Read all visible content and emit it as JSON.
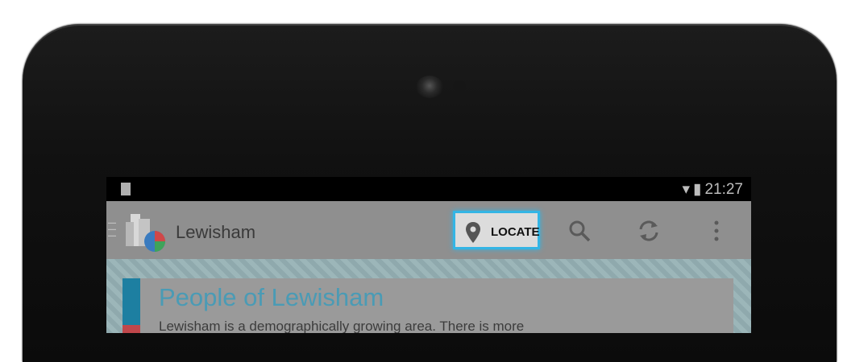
{
  "status_bar": {
    "time": "21:27"
  },
  "action_bar": {
    "title": "Lewisham",
    "locate_label": "LOCATE",
    "icons": [
      "location-pin-icon",
      "search-icon",
      "refresh-icon",
      "overflow-menu-icon"
    ]
  },
  "card": {
    "title": "People of Lewisham",
    "text": "Lewisham is a demographically growing area. There is more"
  },
  "colors": {
    "accent": "#33b5e5",
    "title_blue": "#4a9bb5"
  }
}
